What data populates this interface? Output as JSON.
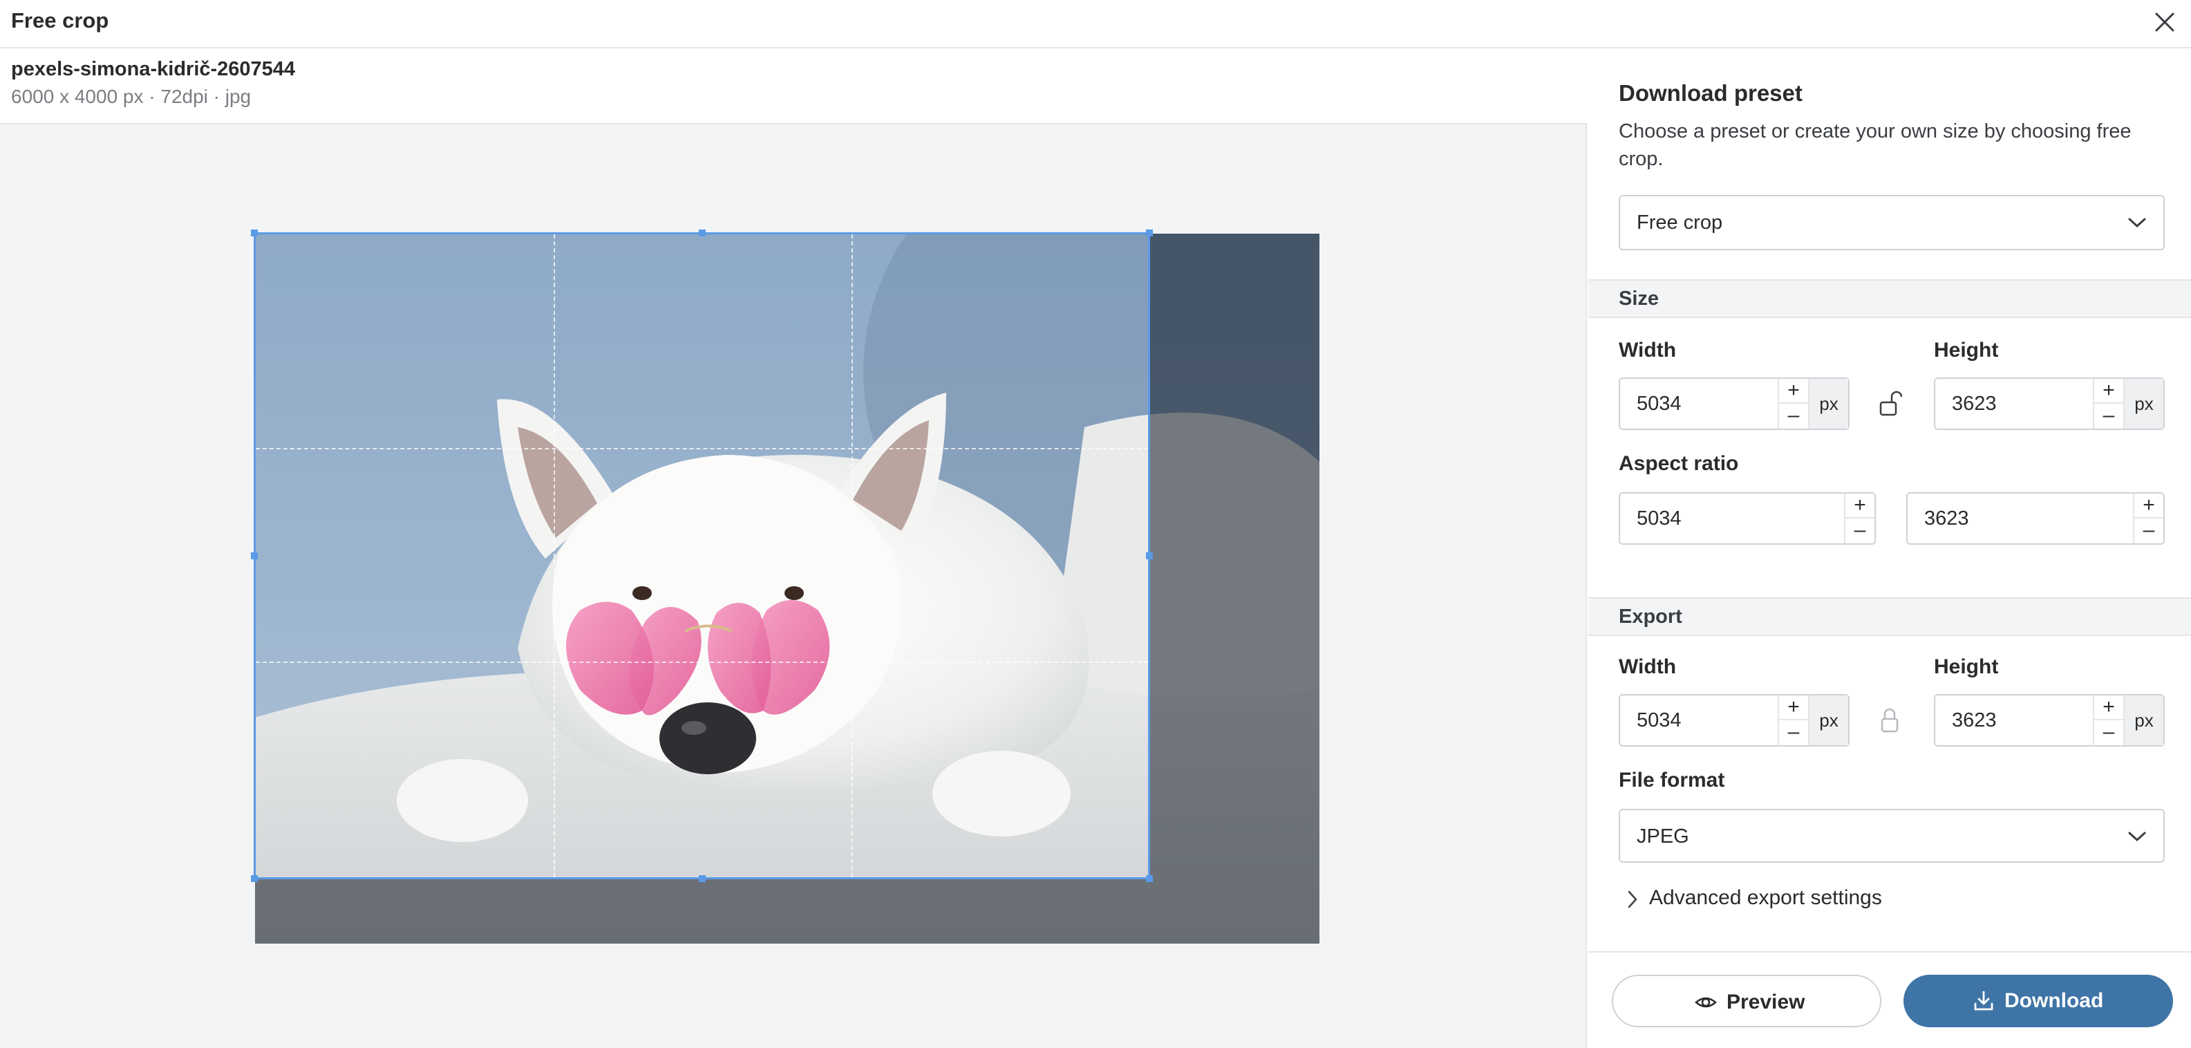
{
  "window": {
    "title": "Free crop",
    "close_icon": "close-icon"
  },
  "file": {
    "name": "pexels-simona-kidrič-2607544",
    "meta": "6000 x 4000 px · 72dpi · jpg"
  },
  "panel": {
    "preset": {
      "heading": "Download preset",
      "description": "Choose a preset or create your own size by choosing free crop.",
      "selected": "Free crop"
    },
    "size": {
      "section_label": "Size",
      "width_label": "Width",
      "height_label": "Height",
      "width": "5034",
      "height": "3623",
      "unit": "px",
      "lock_state": "unlocked",
      "aspect_label": "Aspect ratio",
      "aspect_w": "5034",
      "aspect_h": "3623"
    },
    "export": {
      "section_label": "Export",
      "width_label": "Width",
      "height_label": "Height",
      "width": "5034",
      "height": "3623",
      "unit": "px",
      "lock_state": "locked",
      "format_label": "File format",
      "format": "JPEG",
      "advanced_label": "Advanced export settings"
    },
    "footer": {
      "preview_label": "Preview",
      "download_label": "Download"
    }
  },
  "steppers": {
    "plus": "+",
    "minus": "–"
  },
  "colors": {
    "crop_border": "#5b9ae6",
    "primary": "#3f74a6",
    "canvas_bg": "#f3f4f5"
  }
}
